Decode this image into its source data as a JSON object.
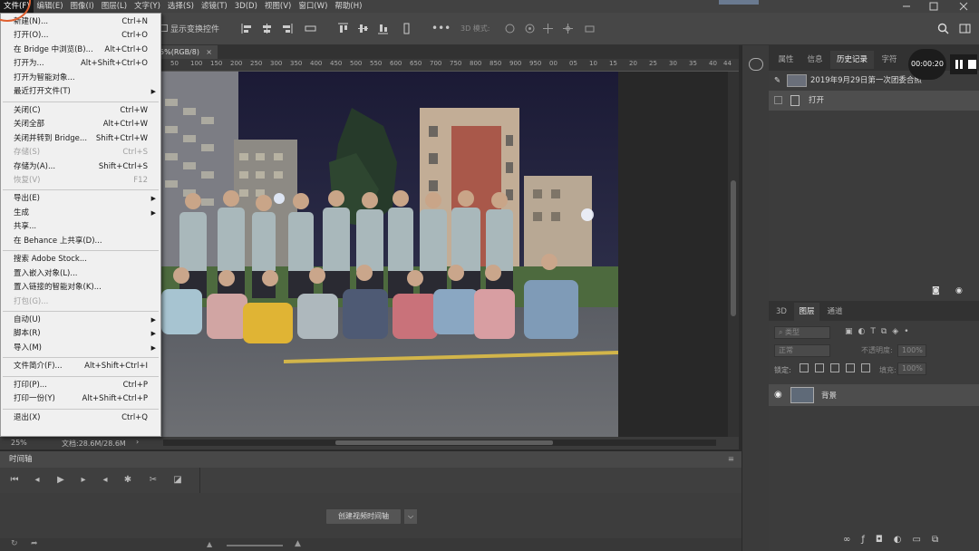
{
  "menubar": {
    "items": [
      "文件(F)",
      "编辑(E)",
      "图像(I)",
      "图层(L)",
      "文字(Y)",
      "选择(S)",
      "滤镜(T)",
      "3D(D)",
      "视图(V)",
      "窗口(W)",
      "帮助(H)"
    ]
  },
  "options_bar": {
    "transform_label": "显示变换控件",
    "mode_3d": "3D 模式:"
  },
  "document": {
    "tab_title": "5%(RGB/8)",
    "tab_close": "×",
    "ruler_ticks": [
      "50",
      "100",
      "150",
      "200",
      "250",
      "300",
      "350",
      "400",
      "450",
      "500",
      "550",
      "600",
      "650",
      "700",
      "750",
      "800",
      "850",
      "900",
      "950",
      "00",
      "05",
      "10",
      "15",
      "20",
      "25",
      "30",
      "35",
      "40",
      "44"
    ]
  },
  "status": {
    "zoom": "25%",
    "doc_info": "文档:28.6M/28.6M",
    "arrow": "›"
  },
  "timeline": {
    "title": "时间轴",
    "create_button": "创建视频时间轴",
    "dropdown_glyph": "⌵"
  },
  "history_panel": {
    "tabs": [
      "属性",
      "信息",
      "历史记录",
      "字符"
    ],
    "snapshot_label": "2019年9月29日第一次团委合照",
    "step_label": "打开"
  },
  "recorder": {
    "time": "00:00:20"
  },
  "layers_panel": {
    "tabs": [
      "3D",
      "图层",
      "通道"
    ],
    "filter_placeholder": "类型",
    "blend_mode": "正常",
    "opacity_label": "不透明度:",
    "opacity_value": "100%",
    "lock_label": "锁定:",
    "fill_label": "填充:",
    "fill_value": "100%",
    "layer_name": "背景"
  },
  "file_menu": {
    "items": [
      {
        "label": "新建(N)...",
        "shortcut": "Ctrl+N",
        "disabled": false
      },
      {
        "label": "打开(O)...",
        "shortcut": "Ctrl+O",
        "disabled": false
      },
      {
        "label": "在 Bridge 中浏览(B)...",
        "shortcut": "Alt+Ctrl+O",
        "disabled": false
      },
      {
        "label": "打开为...",
        "shortcut": "Alt+Shift+Ctrl+O",
        "disabled": false
      },
      {
        "label": "打开为智能对象...",
        "shortcut": "",
        "disabled": false
      },
      {
        "label": "最近打开文件(T)",
        "shortcut": "",
        "disabled": false,
        "submenu": true
      },
      {
        "sep": true
      },
      {
        "label": "关闭(C)",
        "shortcut": "Ctrl+W",
        "disabled": false
      },
      {
        "label": "关闭全部",
        "shortcut": "Alt+Ctrl+W",
        "disabled": false
      },
      {
        "label": "关闭并转到 Bridge...",
        "shortcut": "Shift+Ctrl+W",
        "disabled": false
      },
      {
        "label": "存储(S)",
        "shortcut": "Ctrl+S",
        "disabled": true
      },
      {
        "label": "存储为(A)...",
        "shortcut": "Shift+Ctrl+S",
        "disabled": false
      },
      {
        "label": "恢复(V)",
        "shortcut": "F12",
        "disabled": true
      },
      {
        "sep": true
      },
      {
        "label": "导出(E)",
        "shortcut": "",
        "disabled": false,
        "submenu": true
      },
      {
        "label": "生成",
        "shortcut": "",
        "disabled": false,
        "submenu": true
      },
      {
        "label": "共享...",
        "shortcut": "",
        "disabled": false
      },
      {
        "label": "在 Behance 上共享(D)...",
        "shortcut": "",
        "disabled": false
      },
      {
        "sep": true
      },
      {
        "label": "搜索 Adobe Stock...",
        "shortcut": "",
        "disabled": false
      },
      {
        "label": "置入嵌入对象(L)...",
        "shortcut": "",
        "disabled": false
      },
      {
        "label": "置入链接的智能对象(K)...",
        "shortcut": "",
        "disabled": false
      },
      {
        "label": "打包(G)...",
        "shortcut": "",
        "disabled": true
      },
      {
        "sep": true
      },
      {
        "label": "自动(U)",
        "shortcut": "",
        "disabled": false,
        "submenu": true
      },
      {
        "label": "脚本(R)",
        "shortcut": "",
        "disabled": false,
        "submenu": true
      },
      {
        "label": "导入(M)",
        "shortcut": "",
        "disabled": false,
        "submenu": true
      },
      {
        "sep": true
      },
      {
        "label": "文件简介(F)...",
        "shortcut": "Alt+Shift+Ctrl+I",
        "disabled": false
      },
      {
        "sep": true
      },
      {
        "label": "打印(P)...",
        "shortcut": "Ctrl+P",
        "disabled": false
      },
      {
        "label": "打印一份(Y)",
        "shortcut": "Alt+Shift+Ctrl+P",
        "disabled": false
      },
      {
        "sep": true
      },
      {
        "label": "退出(X)",
        "shortcut": "Ctrl+Q",
        "disabled": false
      }
    ]
  }
}
